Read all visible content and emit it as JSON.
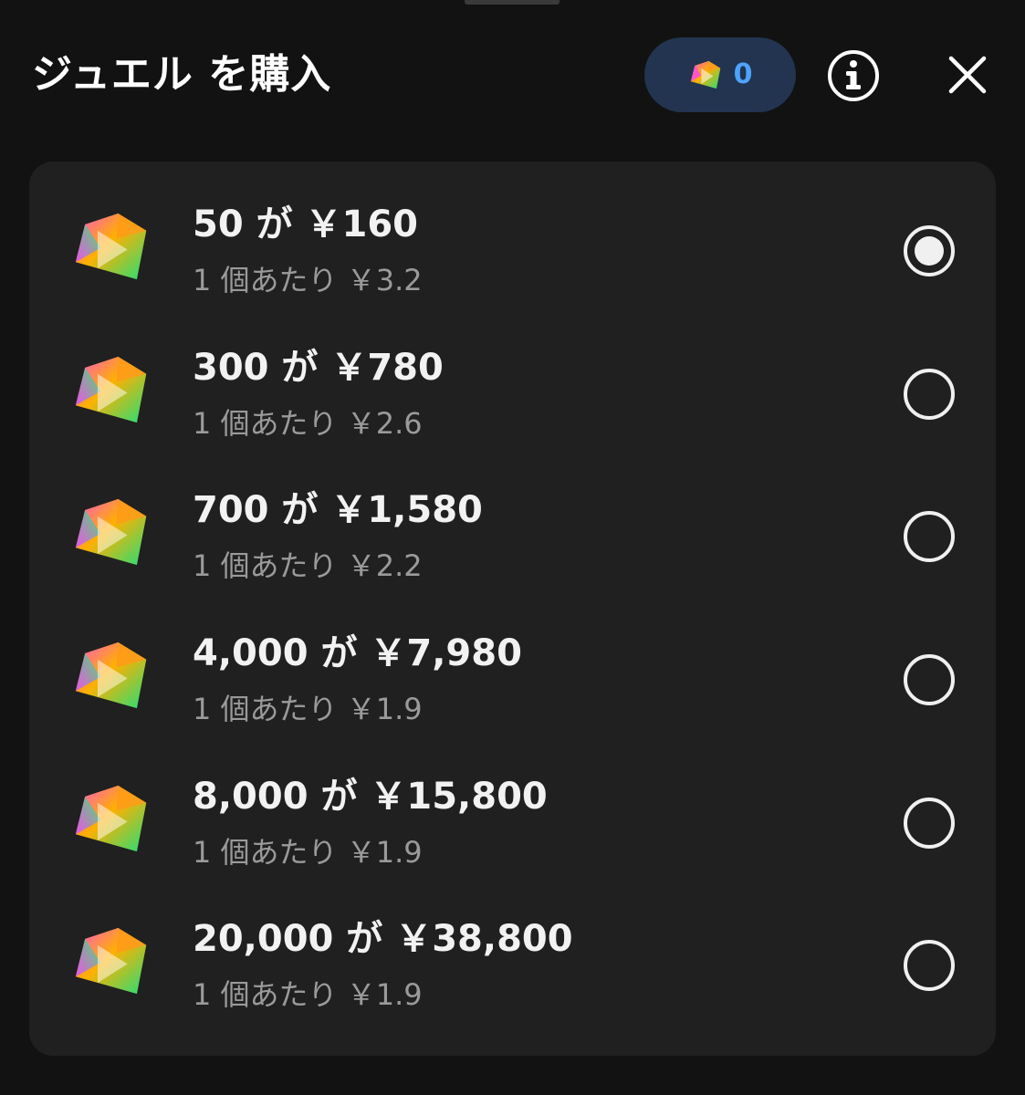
{
  "header": {
    "title": "ジュエル を購入",
    "balance": "0",
    "info_icon": "info-icon",
    "close_icon": "close-icon"
  },
  "colors": {
    "background": "#121212",
    "card": "#202020",
    "balance_pill": "#22344f",
    "balance_text": "#4da3ff",
    "secondary_text": "#9a9a9a"
  },
  "options": [
    {
      "main": "50 が ￥160",
      "sub": "1 個あたり ￥3.2",
      "selected": true
    },
    {
      "main": "300 が ￥780",
      "sub": "1 個あたり ￥2.6",
      "selected": false
    },
    {
      "main": "700 が ￥1,580",
      "sub": "1 個あたり ￥2.2",
      "selected": false
    },
    {
      "main": "4,000 が ￥7,980",
      "sub": "1 個あたり ￥1.9",
      "selected": false
    },
    {
      "main": "8,000 が ￥15,800",
      "sub": "1 個あたり ￥1.9",
      "selected": false
    },
    {
      "main": "20,000 が ￥38,800",
      "sub": "1 個あたり ￥1.9",
      "selected": false
    }
  ]
}
